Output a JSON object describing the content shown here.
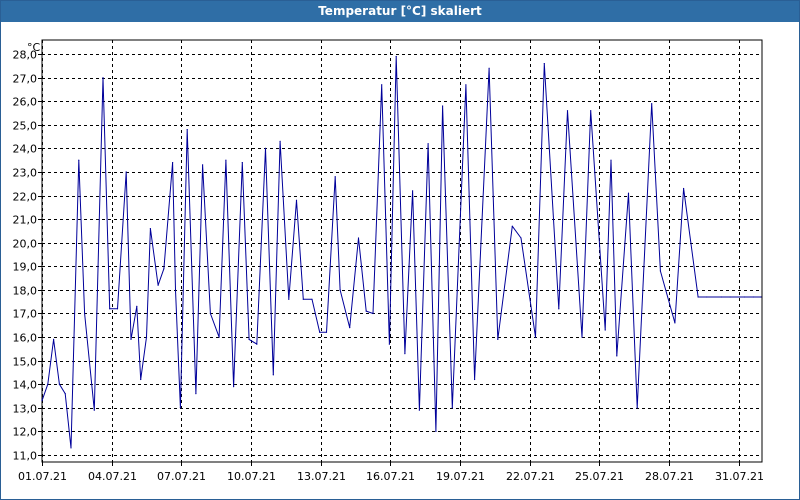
{
  "window": {
    "title": "Temperatur [°C] skaliert"
  },
  "colors": {
    "titlebar": "#2f6ea6",
    "series_line": "#00009a",
    "grid": "#000000"
  },
  "chart_data": {
    "type": "line",
    "title": "Temperatur [°C] skaliert",
    "ylabel": "°C",
    "xlabel": "",
    "ylim": [
      10.7,
      28.6
    ],
    "xlim": [
      "2021-07-01",
      "2021-08-01"
    ],
    "grid": true,
    "y_ticks": [
      11.0,
      12.0,
      13.0,
      14.0,
      15.0,
      16.0,
      17.0,
      18.0,
      19.0,
      20.0,
      21.0,
      22.0,
      23.0,
      24.0,
      25.0,
      26.0,
      27.0,
      28.0
    ],
    "y_tick_labels": [
      "11,0",
      "12,0",
      "13,0",
      "14,0",
      "15,0",
      "16,0",
      "17,0",
      "18,0",
      "19,0",
      "20,0",
      "21,0",
      "22,0",
      "23,0",
      "24,0",
      "25,0",
      "26,0",
      "27,0",
      "28,0"
    ],
    "x_ticks": [
      "2021-07-01",
      "2021-07-04",
      "2021-07-07",
      "2021-07-10",
      "2021-07-13",
      "2021-07-16",
      "2021-07-19",
      "2021-07-22",
      "2021-07-25",
      "2021-07-28",
      "2021-07-31"
    ],
    "x_tick_labels": [
      "01.07.21",
      "04.07.21",
      "07.07.21",
      "10.07.21",
      "13.07.21",
      "16.07.21",
      "19.07.21",
      "22.07.21",
      "25.07.21",
      "28.07.21",
      "31.07.21"
    ],
    "series": [
      {
        "x": [
          "2021-07-01 00:00",
          "2021-07-01 06:00",
          "2021-07-01 12:00",
          "2021-07-01 18:00",
          "2021-07-02 00:00",
          "2021-07-02 06:00",
          "2021-07-02 14:00",
          "2021-07-02 20:00",
          "2021-07-03 06:00",
          "2021-07-03 15:00",
          "2021-07-03 22:00",
          "2021-07-04 06:00",
          "2021-07-04 15:00",
          "2021-07-04 20:00",
          "2021-07-05 02:00",
          "2021-07-05 06:00",
          "2021-07-05 12:00",
          "2021-07-05 16:00",
          "2021-07-06 00:00",
          "2021-07-06 06:00",
          "2021-07-06 15:00",
          "2021-07-06 18:00",
          "2021-07-06 23:00",
          "2021-07-07 06:00",
          "2021-07-07 15:00",
          "2021-07-07 22:00",
          "2021-07-08 06:00",
          "2021-07-08 15:00",
          "2021-07-08 22:00",
          "2021-07-09 06:00",
          "2021-07-09 15:00",
          "2021-07-09 22:00",
          "2021-07-10 06:00",
          "2021-07-10 15:00",
          "2021-07-10 23:00",
          "2021-07-11 06:00",
          "2021-07-11 15:00",
          "2021-07-11 23:00",
          "2021-07-12 06:00",
          "2021-07-12 15:00",
          "2021-07-12 23:00",
          "2021-07-13 06:00",
          "2021-07-13 15:00",
          "2021-07-13 20:00",
          "2021-07-14 06:00",
          "2021-07-14 15:00",
          "2021-07-14 23:00",
          "2021-07-15 06:00",
          "2021-07-15 15:00",
          "2021-07-15 23:00",
          "2021-07-16 06:00",
          "2021-07-16 15:00",
          "2021-07-16 23:00",
          "2021-07-17 06:00",
          "2021-07-17 15:00",
          "2021-07-17 23:00",
          "2021-07-18 06:00",
          "2021-07-18 16:00",
          "2021-07-19 06:00",
          "2021-07-19 15:00",
          "2021-07-20 06:00",
          "2021-07-20 15:00",
          "2021-07-21 06:00",
          "2021-07-21 15:00",
          "2021-07-22 06:00",
          "2021-07-22 15:00",
          "2021-07-23 06:00",
          "2021-07-23 15:00",
          "2021-07-24 06:00",
          "2021-07-24 15:00",
          "2021-07-25 06:00",
          "2021-07-25 12:00",
          "2021-07-25 18:00",
          "2021-07-26 06:00",
          "2021-07-26 15:00",
          "2021-07-27 06:00",
          "2021-07-27 15:00",
          "2021-07-28 06:00",
          "2021-07-28 15:00",
          "2021-07-29 06:00",
          "2021-07-29 15:00",
          "2021-07-30 06:00",
          "2021-07-30 15:00",
          "2021-07-31 06:00",
          "2021-07-31 15:00",
          "2021-07-31 23:00"
        ],
        "y": [
          13.3,
          14.0,
          15.9,
          14.0,
          13.6,
          11.3,
          23.5,
          17.0,
          12.9,
          27.0,
          17.2,
          17.2,
          23.0,
          15.9,
          17.3,
          14.2,
          16.0,
          20.6,
          18.2,
          18.9,
          23.4,
          18.0,
          13.0,
          24.8,
          13.6,
          23.3,
          17.0,
          16.0,
          23.5,
          13.9,
          23.4,
          15.9,
          15.7,
          24.0,
          14.4,
          24.3,
          17.6,
          21.8,
          17.6,
          17.6,
          16.2,
          16.2,
          22.8,
          18.0,
          16.4,
          20.2,
          17.1,
          17.0,
          26.7,
          15.7,
          27.9,
          15.3,
          22.2,
          12.9,
          24.2,
          12.0,
          25.8,
          13.0,
          26.7,
          14.2,
          27.4,
          15.9,
          20.7,
          20.2,
          16.0,
          27.6,
          17.2,
          25.6,
          16.0,
          25.6,
          16.3,
          23.5,
          15.2,
          22.1,
          13.0,
          25.9,
          18.8,
          16.6,
          22.3,
          17.7,
          17.7,
          17.7,
          17.7,
          17.7,
          17.7,
          17.7
        ]
      }
    ]
  }
}
